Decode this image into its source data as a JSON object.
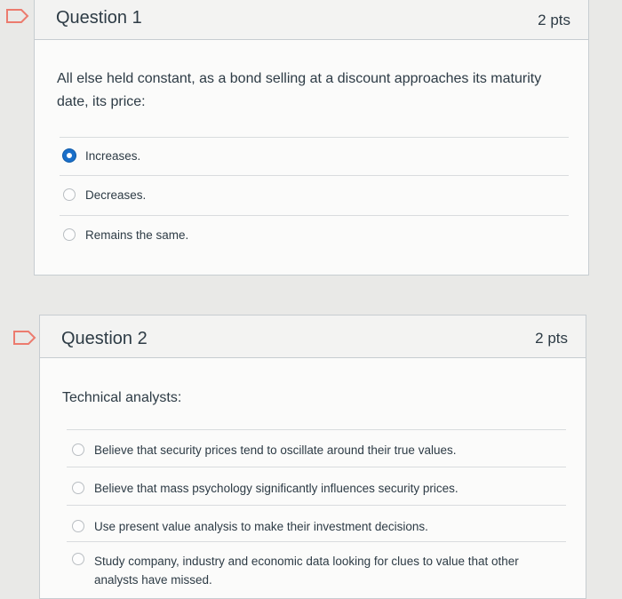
{
  "questions": [
    {
      "title": "Question 1",
      "points": "2 pts",
      "text": "All else held constant, as a bond selling at a discount approaches its maturity date, its price:",
      "answers": [
        {
          "label": "Increases.",
          "selected": true
        },
        {
          "label": "Decreases.",
          "selected": false
        },
        {
          "label": "Remains the same.",
          "selected": false
        }
      ]
    },
    {
      "title": "Question 2",
      "points": "2 pts",
      "text": "Technical analysts:",
      "answers": [
        {
          "label": "Believe that security prices tend to oscillate around their true values.",
          "selected": false
        },
        {
          "label": "Believe that mass psychology significantly influences security prices.",
          "selected": false
        },
        {
          "label": "Use present value analysis to make their investment decisions.",
          "selected": false
        },
        {
          "label": "Study company, industry and economic data looking for clues to value that other analysts have missed.",
          "selected": false
        }
      ]
    }
  ],
  "colors": {
    "accent": "#1a6fc9",
    "flag": "#ec7b6e",
    "text": "#2d3b45",
    "border": "#c7cdd1"
  },
  "icons": {
    "flag": "flag-icon",
    "radio": "radio-button"
  }
}
